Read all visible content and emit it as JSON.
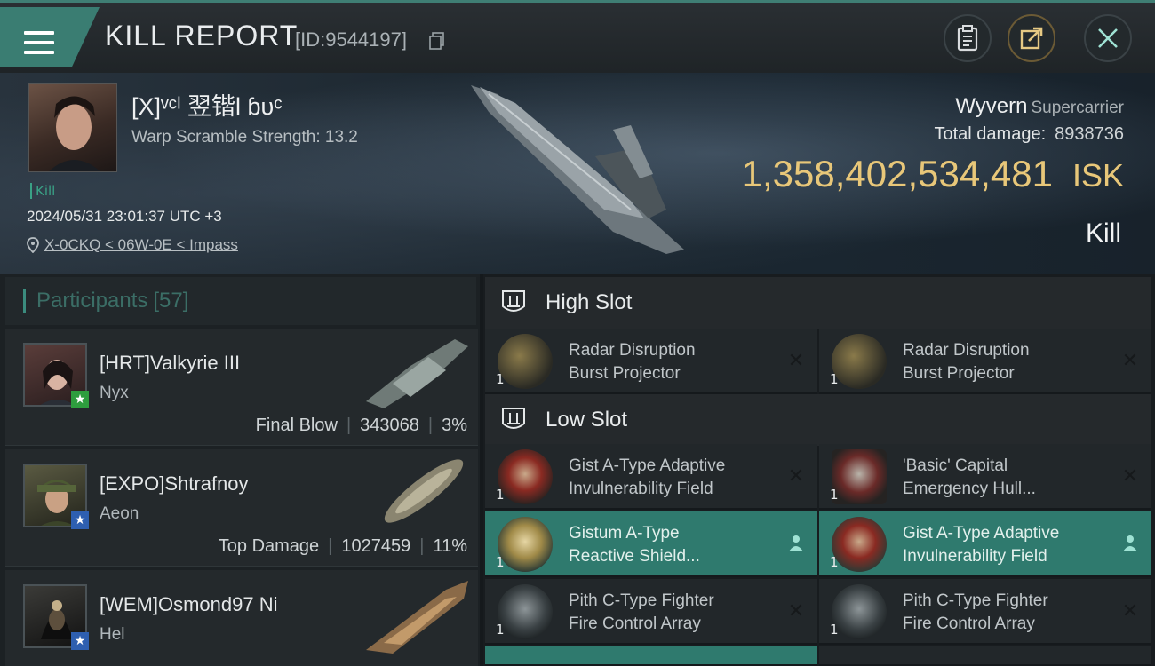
{
  "header": {
    "title": "KILL REPORT",
    "report_id": "[ID:9544197]",
    "buttons": [
      "clipboard-icon",
      "share-icon",
      "close-icon"
    ]
  },
  "victim": {
    "name": "[X]ᵛᶜˡ 翌锴l ɓᴜᶜ",
    "warp_scramble": "Warp Scramble Strength: 13.2",
    "tag": "Kill",
    "timestamp": "2024/05/31 23:01:37 UTC +3",
    "location": "X-0CKQ < 06W-0E < Impass",
    "ship_name": "Wyvern",
    "ship_class": "Supercarrier",
    "total_damage_label": "Total damage:",
    "total_damage": "8938736",
    "isk_value": "1,358,402,534,481",
    "isk_unit": "ISK",
    "result": "Kill"
  },
  "participants": {
    "label": "Participants",
    "count": "[57]",
    "items": [
      {
        "name": "[HRT]Valkyrie III",
        "ship": "Nyx",
        "role": "Final Blow",
        "damage": "343068",
        "percent": "3%",
        "badge_color": "#2e9d3e",
        "badge_icon": "★"
      },
      {
        "name": "[EXPO]Shtrafnoy",
        "ship": "Aeon",
        "role": "Top Damage",
        "damage": "1027459",
        "percent": "11%",
        "badge_color": "#2e5fb0",
        "badge_icon": "★"
      },
      {
        "name": "[WEM]Osmond97 Ni",
        "ship": "Hel",
        "role": "",
        "damage": "",
        "percent": "",
        "badge_color": "#2e5fb0",
        "badge_icon": "★"
      }
    ]
  },
  "fitting": {
    "high_slot_label": "High Slot",
    "low_slot_label": "Low Slot",
    "high": [
      {
        "line1": "Radar Disruption",
        "line2": "Burst Projector",
        "qty": "1",
        "action": "✕",
        "active": false
      },
      {
        "line1": "Radar Disruption",
        "line2": "Burst Projector",
        "qty": "1",
        "action": "✕",
        "active": false
      }
    ],
    "low": [
      {
        "line1": "Gist A-Type Adaptive",
        "line2": "Invulnerability Field",
        "qty": "1",
        "action": "✕",
        "active": false
      },
      {
        "line1": "'Basic' Capital",
        "line2": "Emergency Hull...",
        "qty": "1",
        "action": "✕",
        "active": false
      },
      {
        "line1": "Gistum A-Type",
        "line2": "Reactive Shield...",
        "qty": "1",
        "action": "person",
        "active": true
      },
      {
        "line1": "Gist A-Type Adaptive",
        "line2": "Invulnerability Field",
        "qty": "1",
        "action": "person",
        "active": true
      },
      {
        "line1": "Pith C-Type Fighter",
        "line2": "Fire Control Array",
        "qty": "1",
        "action": "✕",
        "active": false
      },
      {
        "line1": "Pith C-Type Fighter",
        "line2": "Fire Control Array",
        "qty": "1",
        "action": "✕",
        "active": false
      }
    ]
  },
  "colors": {
    "accent": "#3a7d72",
    "isk": "#e8c779",
    "active_row": "#2f7a6e"
  }
}
